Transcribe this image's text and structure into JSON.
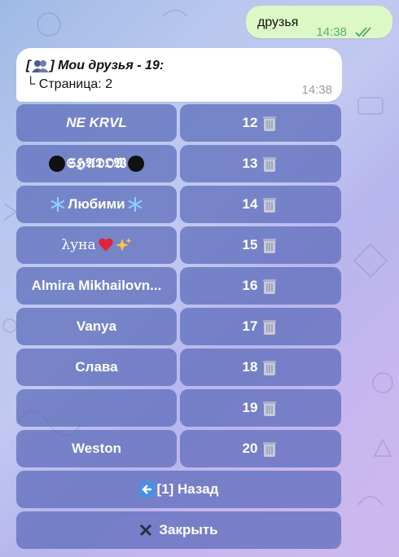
{
  "outgoing_message": {
    "text": "друзья",
    "time": "14:38"
  },
  "incoming_message": {
    "title_prefix": "[",
    "title_suffix": "] Мои друзья - 19:",
    "subtitle": "└ Страница: 2",
    "time": "14:38",
    "icon": "busts-in-silhouette-icon"
  },
  "friends": [
    {
      "name": "NE KRVL",
      "number": "12"
    },
    {
      "name": "𝕾𝕳𝕬𝕯𝕺𝖂",
      "number": "13"
    },
    {
      "name": "Любими",
      "number": "14"
    },
    {
      "name": "λуна",
      "number": "15"
    },
    {
      "name": "Almira Mikhailovn...",
      "number": "16"
    },
    {
      "name": "Vanya",
      "number": "17"
    },
    {
      "name": "Слава",
      "number": "18"
    },
    {
      "name": "",
      "number": "19"
    },
    {
      "name": "Weston",
      "number": "20"
    }
  ],
  "keyboard": {
    "back_label": "[1] Назад",
    "close_label": "Закрыть",
    "delete_icon": "wastebasket-icon",
    "back_icon": "left-arrow-icon",
    "close_icon": "cross-mark-icon"
  },
  "colors": {
    "button": "#5a69b9",
    "outgoing_bubble": "#dcf8c6",
    "incoming_bubble": "#ffffff",
    "read_check": "#5dae6a"
  }
}
